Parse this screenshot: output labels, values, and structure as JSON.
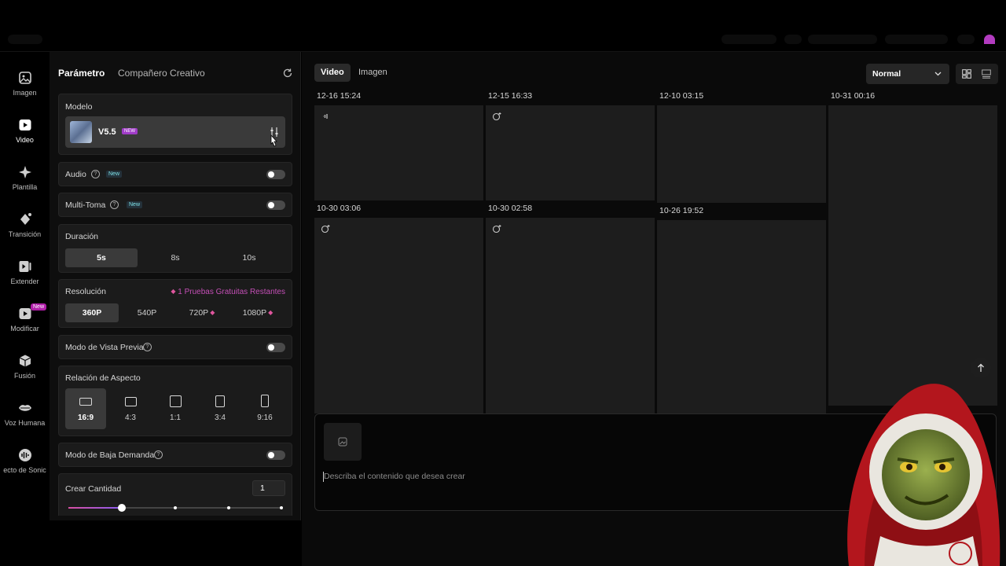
{
  "rail": {
    "items": [
      {
        "label": "Imagen",
        "icon": "image-icon"
      },
      {
        "label": "Video",
        "icon": "video-icon"
      },
      {
        "label": "Plantilla",
        "icon": "sparkle-icon"
      },
      {
        "label": "Transición",
        "icon": "transition-icon"
      },
      {
        "label": "Extender",
        "icon": "extend-icon"
      },
      {
        "label": "Modificar",
        "icon": "modify-icon",
        "badge": "New"
      },
      {
        "label": "Fusión",
        "icon": "cube-icon"
      },
      {
        "label": "Voz Humana",
        "icon": "lips-icon"
      },
      {
        "label": "ecto de Sonic",
        "icon": "sound-icon"
      }
    ]
  },
  "panel": {
    "tab_params": "Parámetro",
    "tab_companion": "Compañero Creativo",
    "model": {
      "title": "Modelo",
      "name": "V5.5",
      "badge": "NEW"
    },
    "audio": {
      "label": "Audio",
      "badge": "New"
    },
    "multishot": {
      "label": "Multi-Toma",
      "badge": "New"
    },
    "duration": {
      "title": "Duración",
      "options": [
        "5s",
        "8s",
        "10s"
      ],
      "selected": "5s"
    },
    "resolution": {
      "title": "Resolución",
      "note": "1 Pruebas Gratuitas Restantes",
      "options": [
        "360P",
        "540P",
        "720P",
        "1080P"
      ],
      "selected": "360P"
    },
    "preview_mode": {
      "label": "Modo de Vista Previa"
    },
    "aspect": {
      "title": "Relación de Aspecto",
      "options": [
        "16:9",
        "4:3",
        "1:1",
        "3:4",
        "9:16"
      ],
      "selected": "16:9"
    },
    "low_demand": {
      "label": "Modo de Baja Demanda"
    },
    "quantity": {
      "title": "Crear Cantidad",
      "value": "1"
    }
  },
  "main": {
    "tabs": [
      "Video",
      "Imagen"
    ],
    "active_tab": "Video",
    "sort_select": "Normal",
    "timestamps": [
      "12-16 15:24",
      "12-15 16:33",
      "12-10 03:15",
      "10-31 00:16",
      "10-30 03:06",
      "10-30 02:58",
      "10-26 19:52"
    ],
    "prompt_placeholder": "Describa el contenido que desea crear"
  },
  "colors": {
    "accent": "#b01ea8",
    "panel_bg": "#0e0e0e",
    "card_bg": "#1b1b1b",
    "tile_bg": "#1d1d1d"
  }
}
